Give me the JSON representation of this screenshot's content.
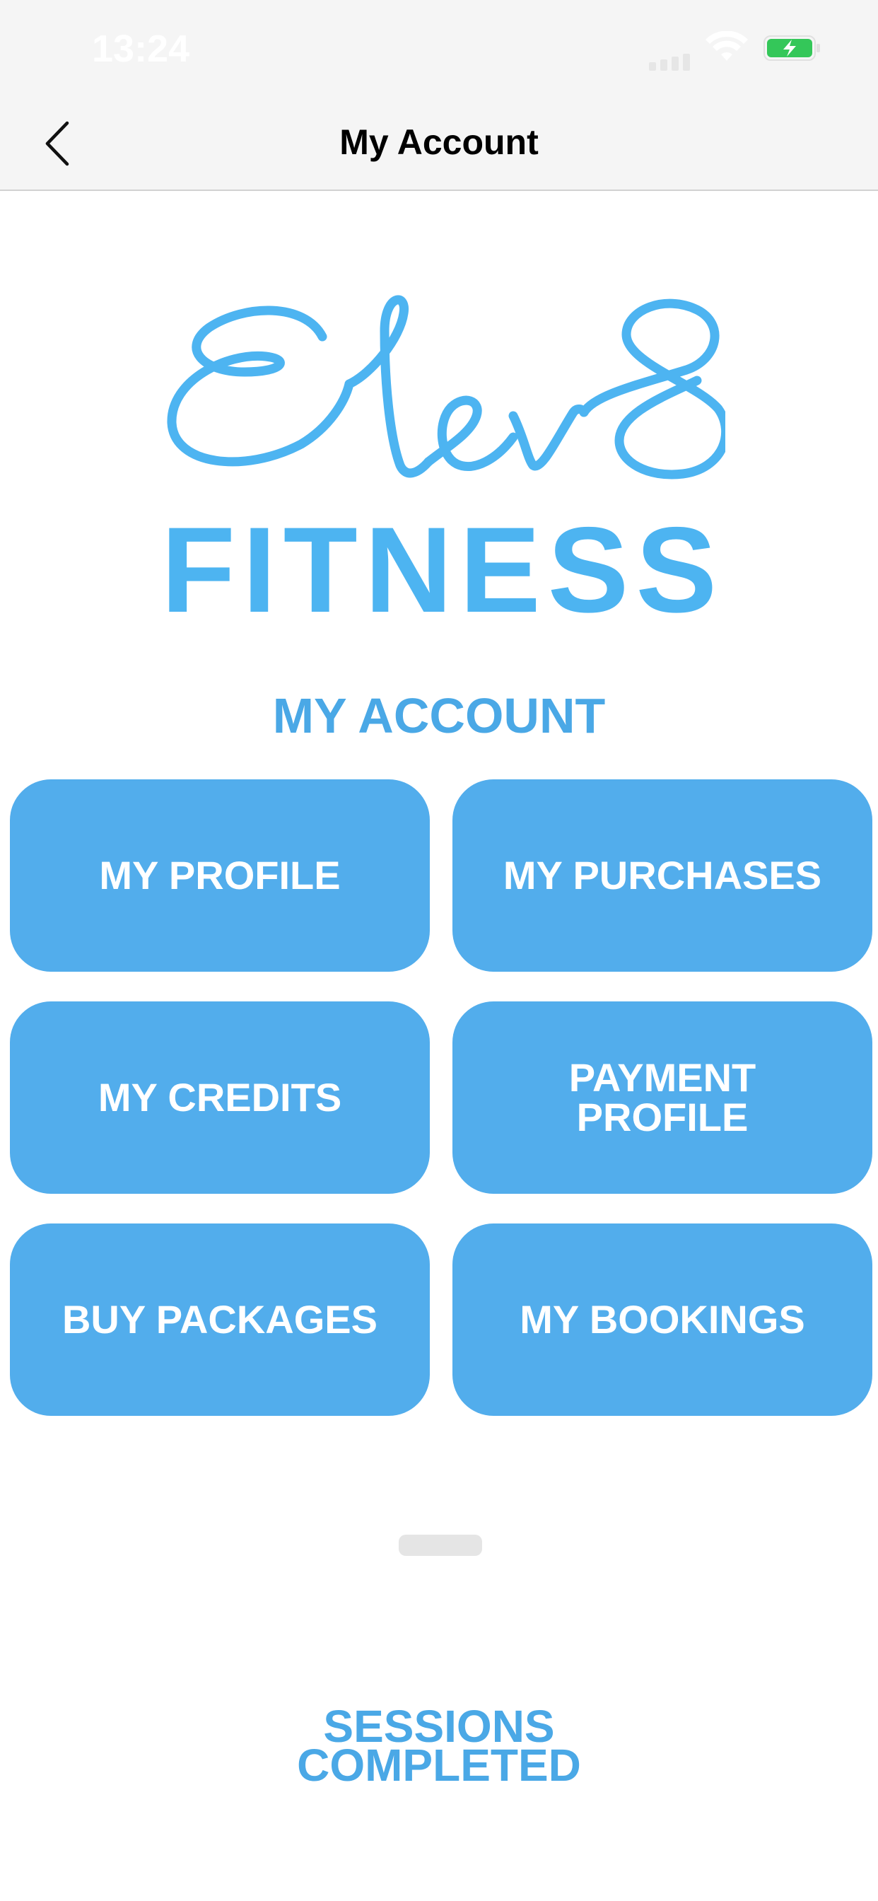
{
  "status_bar": {
    "time": "13:24",
    "icons": [
      "cellular-signal-icon",
      "wifi-icon",
      "battery-charging-icon"
    ],
    "battery_color": "#34c759"
  },
  "nav": {
    "back_icon": "chevron-left-icon",
    "title": "My Account"
  },
  "logo": {
    "script_text": "Elev8",
    "subtitle": "FITNESS",
    "brand_color": "#4db4f1"
  },
  "section_title": "MY ACCOUNT",
  "buttons": [
    {
      "label": "MY PROFILE"
    },
    {
      "label": "MY PURCHASES"
    },
    {
      "label": "MY CREDITS"
    },
    {
      "label": "PAYMENT\nPROFILE"
    },
    {
      "label": "BUY PACKAGES"
    },
    {
      "label": "MY BOOKINGS"
    }
  ],
  "button_color": "#52adec",
  "sessions": {
    "label": "SESSIONS\nCOMPLETED"
  }
}
